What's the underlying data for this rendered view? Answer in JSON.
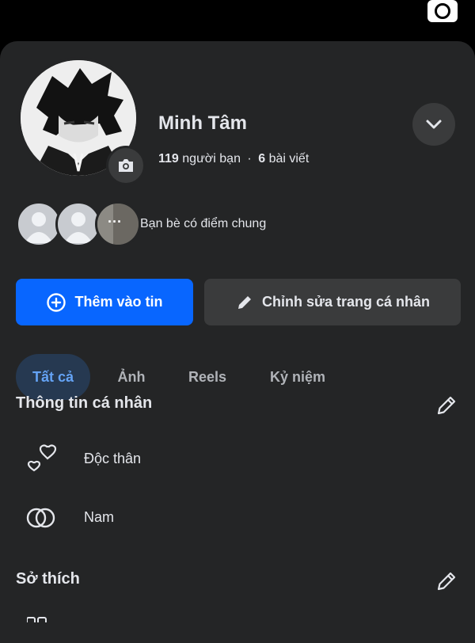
{
  "profile": {
    "name": "Minh Tâm",
    "friends_count": "119",
    "friends_label": "người bạn",
    "separator": "·",
    "posts_count": "6",
    "posts_label": "bài viết"
  },
  "mutual_friends": {
    "label": "Bạn bè có điểm chung",
    "more_glyph": "···"
  },
  "buttons": {
    "add_story": "Thêm vào tin",
    "edit_profile": "Chỉnh sửa trang cá nhân"
  },
  "tabs": [
    {
      "label": "Tất cả",
      "active": true
    },
    {
      "label": "Ảnh",
      "active": false
    },
    {
      "label": "Reels",
      "active": false
    },
    {
      "label": "Kỷ niệm",
      "active": false
    }
  ],
  "personal_info": {
    "title": "Thông tin cá nhân",
    "items": [
      {
        "icon": "hearts-icon",
        "text": "Độc thân"
      },
      {
        "icon": "gender-rings-icon",
        "text": "Nam"
      }
    ]
  },
  "hobbies": {
    "title": "Sở thích"
  },
  "icons": {
    "top_right": "camera-icon",
    "avatar_badge": "camera-icon",
    "dropdown": "chevron-down-icon",
    "add_story": "plus-circle-icon",
    "edit_profile": "pencil-icon",
    "section_edit": "pencil-outline-icon"
  },
  "colors": {
    "background": "#242526",
    "primary_button": "#0866ff",
    "secondary_button": "#3a3b3c",
    "active_tab_bg": "#263951",
    "active_tab_text": "#64a3f5",
    "text": "#e4e6eb",
    "muted_text": "#b0b3b8"
  }
}
